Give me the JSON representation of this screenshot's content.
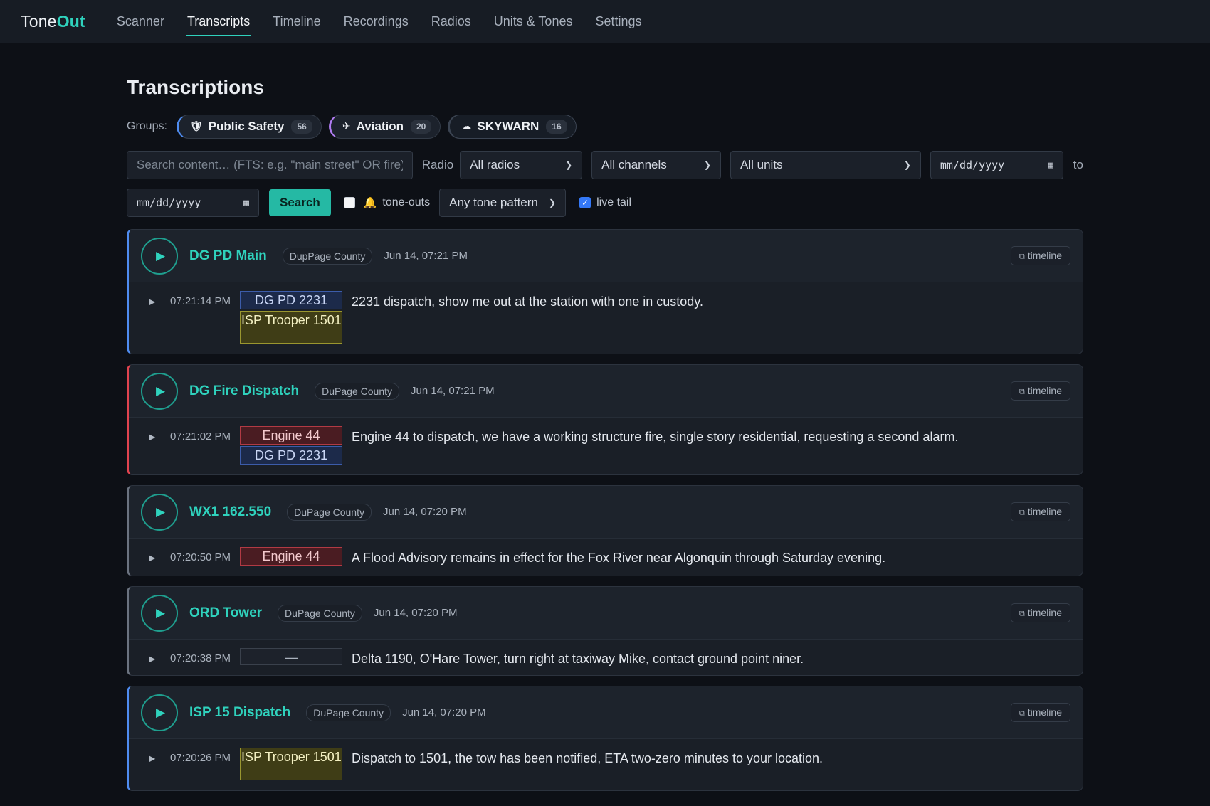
{
  "app": {
    "logo_main": "Tone",
    "logo_accent": "Out"
  },
  "nav": [
    {
      "label": "Scanner",
      "active": false
    },
    {
      "label": "Transcripts",
      "active": true
    },
    {
      "label": "Timeline",
      "active": false
    },
    {
      "label": "Recordings",
      "active": false
    },
    {
      "label": "Radios",
      "active": false
    },
    {
      "label": "Units & Tones",
      "active": false
    },
    {
      "label": "Settings",
      "active": false
    }
  ],
  "page": {
    "title": "Transcriptions"
  },
  "groups": {
    "label": "Groups:",
    "items": [
      {
        "icon": "shield-icon",
        "glyph": "🛡",
        "label": "Public Safety",
        "count": "56"
      },
      {
        "icon": "airplane-icon",
        "glyph": "✈",
        "label": "Aviation",
        "count": "20"
      },
      {
        "icon": "cloud-icon",
        "glyph": "☁",
        "label": "SKYWARN",
        "count": "16"
      }
    ]
  },
  "filters": {
    "search_placeholder": "Search content… (FTS: e.g. \"main street\" OR fire)",
    "search_value": "",
    "radio_label": "Radio",
    "radio_value": "All radios",
    "channel_value": "All channels",
    "unit_value": "All units",
    "date_from": "mm/dd/yyyy",
    "to_label": "to",
    "date_to": "mm/dd/yyyy",
    "search_button": "Search",
    "toneouts_label": "tone-outs",
    "toneouts_checked": false,
    "tone_pattern_value": "Any tone pattern",
    "livetail_label": "live tail",
    "livetail_checked": true
  },
  "colors": {
    "accent": "#2fd2bd",
    "police": "#4f8cf0",
    "fire": "#e0434f",
    "neutral": "#6b7380"
  },
  "cards": [
    {
      "channel": "DG PD Main",
      "county": "DupPage County",
      "stamp": "Jun 14, 07:21 PM",
      "kind": "police",
      "timeline_label": "timeline",
      "entries": [
        {
          "time": "07:21:14 PM",
          "units": [
            {
              "label": "DG PD 2231",
              "type": "police"
            },
            {
              "label": "ISP Trooper 1501",
              "type": "trooper"
            }
          ],
          "text": "2231 dispatch, show me out at the station with one in custody."
        }
      ]
    },
    {
      "channel": "DG Fire Dispatch",
      "county": "DuPage County",
      "stamp": "Jun 14, 07:21 PM",
      "kind": "fire",
      "timeline_label": "timeline",
      "entries": [
        {
          "time": "07:21:02 PM",
          "units": [
            {
              "label": "Engine 44",
              "type": "fire"
            },
            {
              "label": "DG PD 2231",
              "type": "police"
            }
          ],
          "text": "Engine 44 to dispatch, we have a working structure fire, single story residential, requesting a second alarm."
        }
      ]
    },
    {
      "channel": "WX1 162.550",
      "county": "DuPage County",
      "stamp": "Jun 14, 07:20 PM",
      "kind": "neutral",
      "timeline_label": "timeline",
      "entries": [
        {
          "time": "07:20:50 PM",
          "units": [
            {
              "label": "Engine 44",
              "type": "fire"
            }
          ],
          "text": "A Flood Advisory remains in effect for the Fox River near Algonquin through Saturday evening."
        }
      ]
    },
    {
      "channel": "ORD Tower",
      "county": "DuPage County",
      "stamp": "Jun 14, 07:20 PM",
      "kind": "neutral",
      "timeline_label": "timeline",
      "entries": [
        {
          "time": "07:20:38 PM",
          "units": [
            {
              "label": "—",
              "type": "none"
            }
          ],
          "text": "Delta 1190, O'Hare Tower, turn right at taxiway Mike, contact ground point niner."
        }
      ]
    },
    {
      "channel": "ISP 15 Dispatch",
      "county": "DuPage County",
      "stamp": "Jun 14, 07:20 PM",
      "kind": "police",
      "timeline_label": "timeline",
      "entries": [
        {
          "time": "07:20:26 PM",
          "units": [
            {
              "label": "ISP Trooper 1501",
              "type": "trooper"
            }
          ],
          "text": "Dispatch to 1501, the tow has been notified, ETA two-zero minutes to your location."
        }
      ]
    }
  ]
}
